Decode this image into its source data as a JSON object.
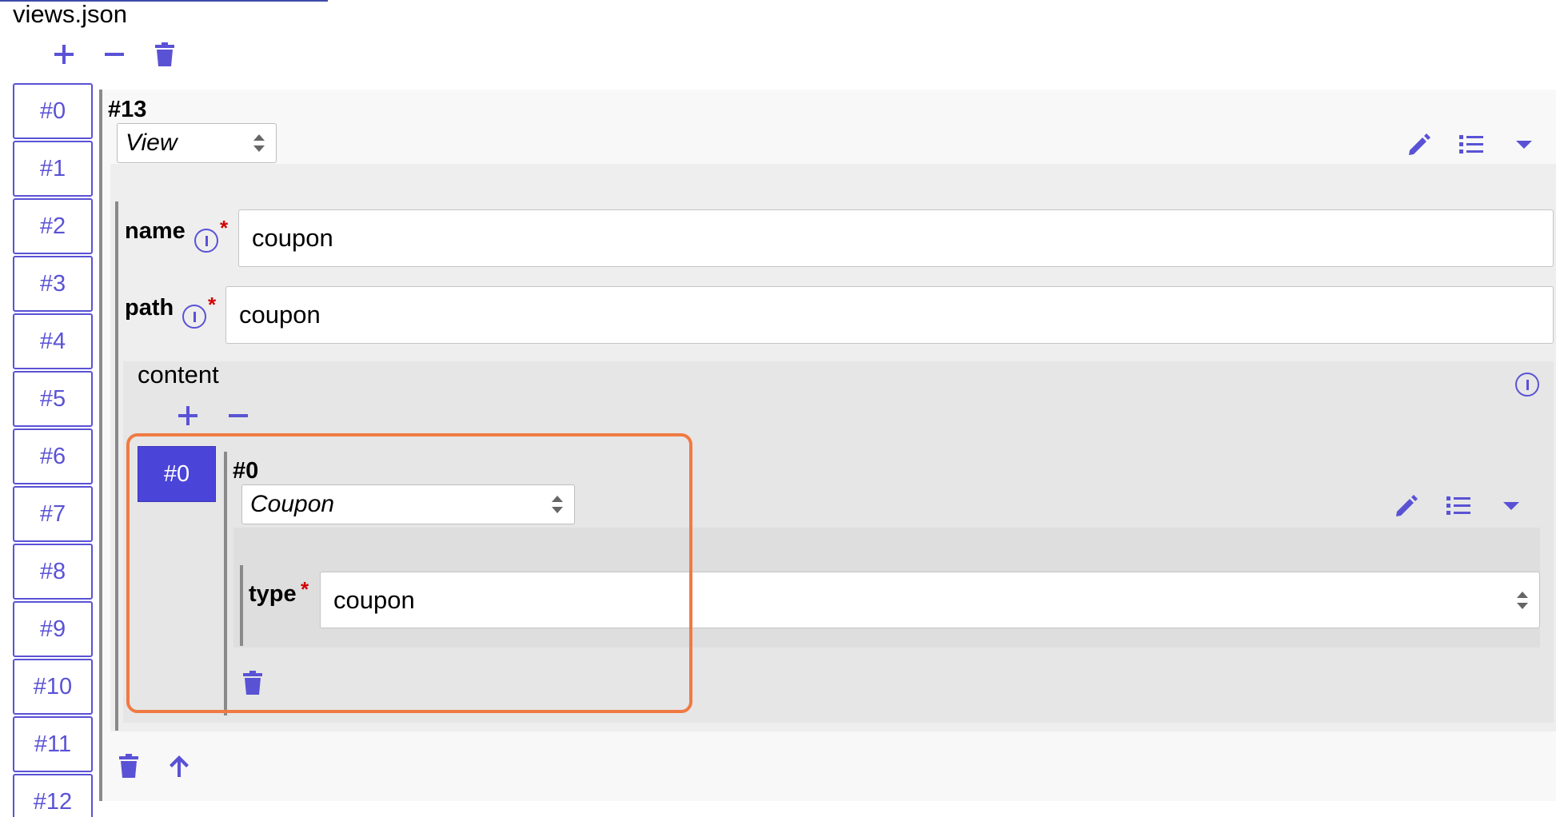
{
  "app": {
    "title": "views.json",
    "accent_color": "#5a52d5",
    "highlight_color": "#f07a43"
  },
  "toolbar": {
    "add_icon": "plus-icon",
    "remove_icon": "minus-icon",
    "delete_icon": "trash-icon"
  },
  "tabs": [
    {
      "label": "#0"
    },
    {
      "label": "#1"
    },
    {
      "label": "#2"
    },
    {
      "label": "#3"
    },
    {
      "label": "#4"
    },
    {
      "label": "#5"
    },
    {
      "label": "#6"
    },
    {
      "label": "#7"
    },
    {
      "label": "#8"
    },
    {
      "label": "#9"
    },
    {
      "label": "#10"
    },
    {
      "label": "#11"
    },
    {
      "label": "#12"
    }
  ],
  "item": {
    "heading": "#13",
    "type_select": "View",
    "actions": [
      "pencil-icon",
      "list-icon",
      "caret-down-icon"
    ],
    "fields": {
      "name": {
        "label": "name",
        "required_mark": "*",
        "value": "coupon"
      },
      "path": {
        "label": "path",
        "required_mark": "*",
        "value": "coupon"
      }
    },
    "content": {
      "label": "content",
      "tabs": [
        {
          "label": "#0"
        }
      ],
      "entry": {
        "heading": "#0",
        "type_select": "Coupon",
        "type_field": {
          "label": "type",
          "required_mark": "*",
          "value": "coupon"
        }
      }
    }
  }
}
